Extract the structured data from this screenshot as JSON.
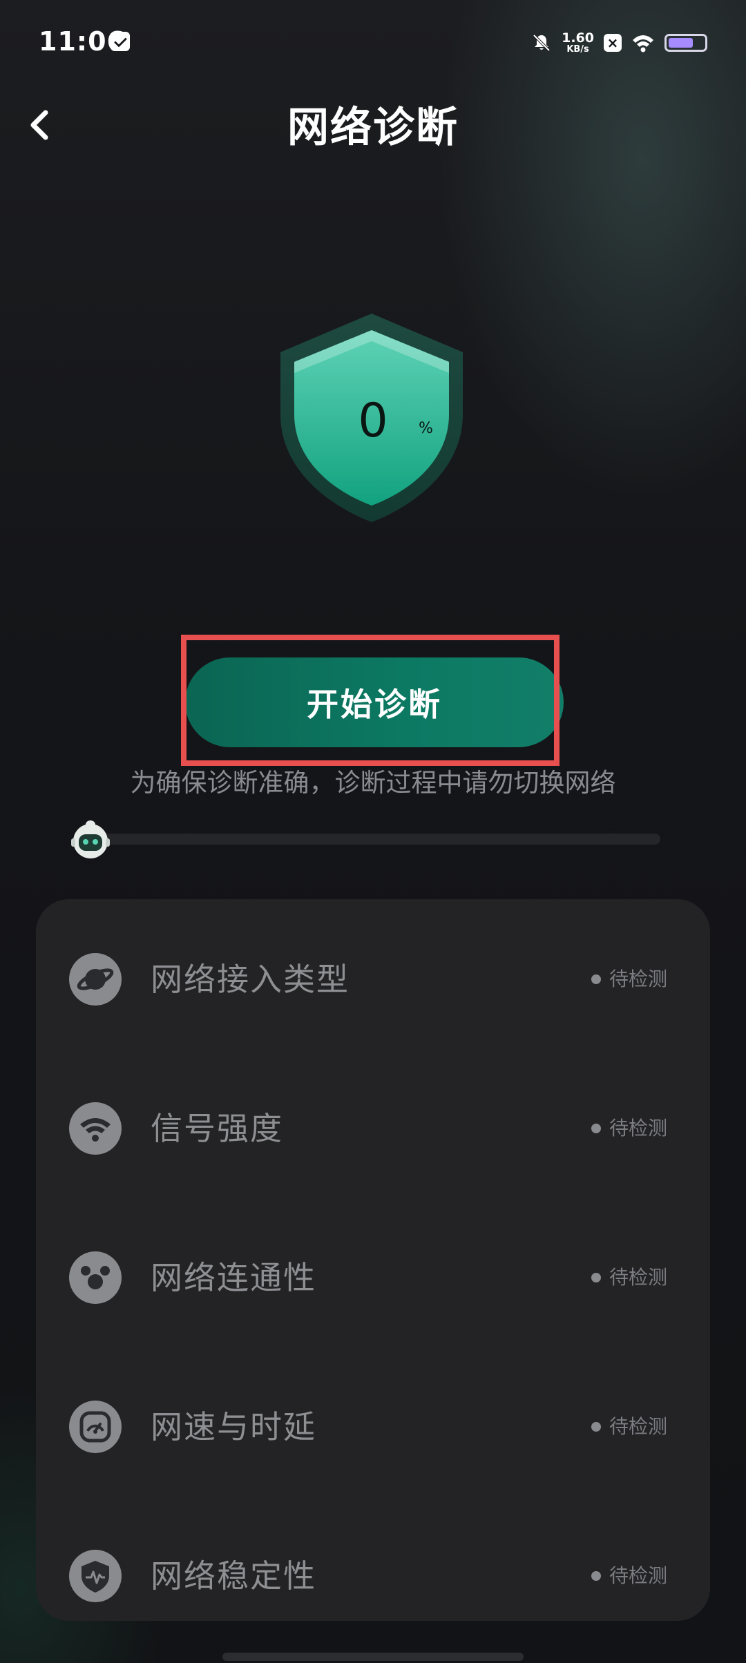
{
  "status_bar": {
    "time": "11:06",
    "net_speed_value": "1.60",
    "net_speed_unit": "KB/s",
    "battery_level_percent": 70
  },
  "header": {
    "title": "网络诊断"
  },
  "shield": {
    "value": "0",
    "unit": "%"
  },
  "actions": {
    "start_label": "开始诊断"
  },
  "hint": "为确保诊断准确，诊断过程中请勿切换网络",
  "progress": {
    "fraction": 0
  },
  "checks": [
    {
      "label": "网络接入类型",
      "status": "待检测",
      "icon": "planet-icon"
    },
    {
      "label": "信号强度",
      "status": "待检测",
      "icon": "wifi-signal-icon"
    },
    {
      "label": "网络连通性",
      "status": "待检测",
      "icon": "connectivity-icon"
    },
    {
      "label": "网速与时延",
      "status": "待检测",
      "icon": "speedometer-icon"
    },
    {
      "label": "网络稳定性",
      "status": "待检测",
      "icon": "shield-pulse-icon"
    }
  ],
  "colors": {
    "accent": "#0c7a63",
    "highlight": "#e84f4f",
    "background": "#151619",
    "card": "#232326"
  }
}
